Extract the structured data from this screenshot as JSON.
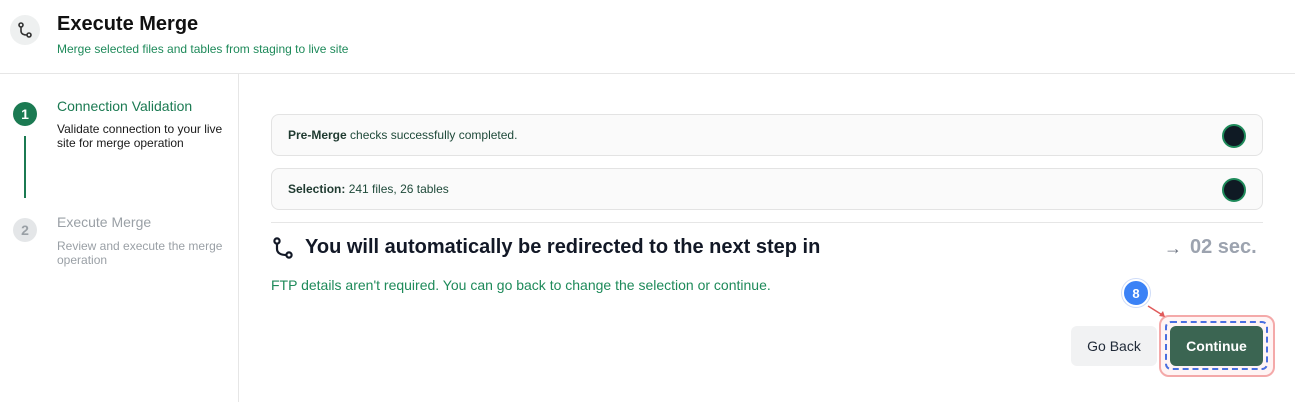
{
  "header": {
    "title": "Execute Merge",
    "subtitle": "Merge selected files and tables from staging to live site",
    "icon": "git-merge-icon"
  },
  "steps": [
    {
      "number": "1",
      "title": "Connection Validation",
      "description": "Validate connection to your live site for merge operation",
      "state": "active"
    },
    {
      "number": "2",
      "title": "Execute Merge",
      "description": "Review and execute the merge operation",
      "state": "inactive"
    }
  ],
  "checks": [
    {
      "label": "Pre-Merge",
      "text": "checks successfully completed."
    },
    {
      "label": "Selection:",
      "text": "241 files, 26 tables"
    }
  ],
  "redirect": {
    "message": "You will automatically be redirected to the next step in",
    "countdown": "02 sec.",
    "icon": "git-merge-icon",
    "arrow_icon": "arrow-right-icon"
  },
  "info": "FTP details aren't required. You can go back to change the selection or continue.",
  "actions": {
    "go_back": "Go Back",
    "continue": "Continue"
  },
  "annotation": {
    "badge": "8"
  },
  "colors": {
    "accent": "#1b7a52",
    "link_green": "#1e8a5a",
    "continue_bg": "#3b6552",
    "badge_blue": "#3b82f6"
  }
}
